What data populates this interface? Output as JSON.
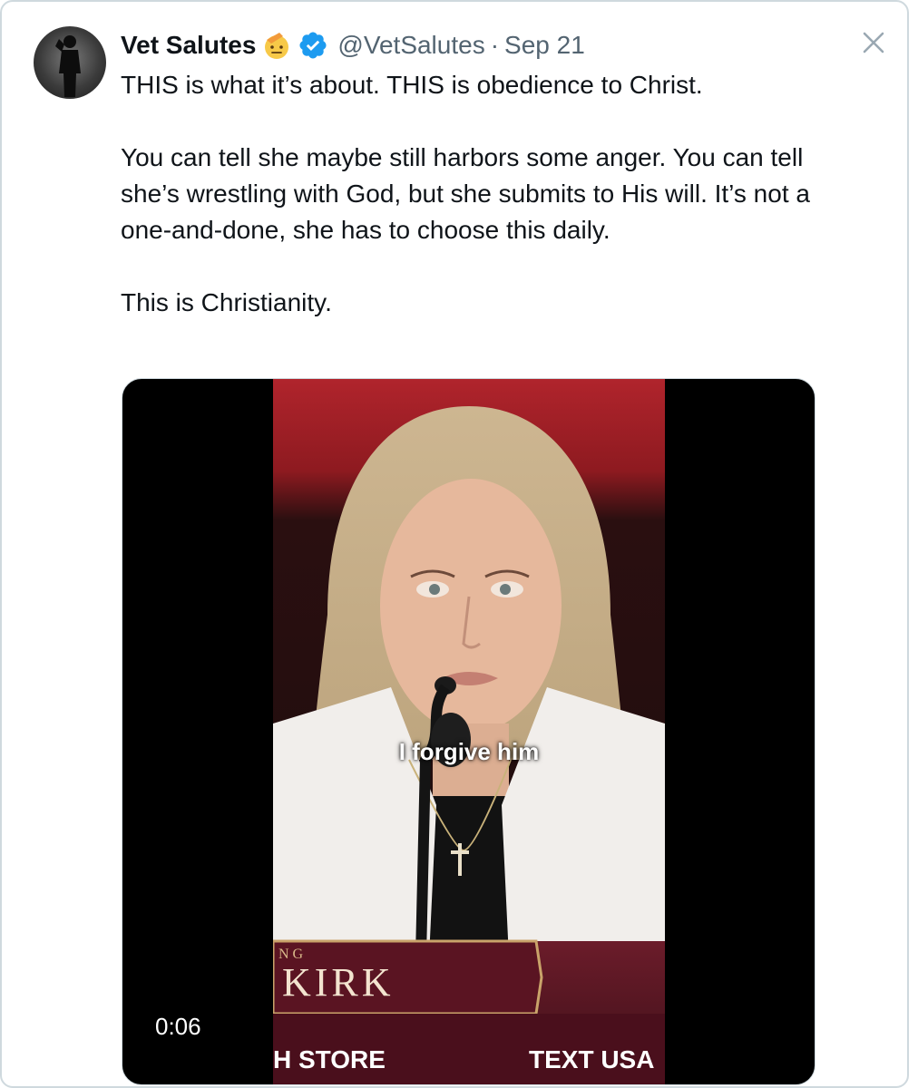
{
  "tweet": {
    "author_name": "Vet Salutes",
    "handle": "@VetSalutes",
    "separator": "·",
    "date": "Sep 21",
    "paragraphs": [
      "THIS is what it’s about. THIS is obedience to Christ.",
      "You can tell she maybe still harbors some anger. You can tell she’s wrestling with God, but she submits to His will. It’s not a one-and-done, she has to choose this daily.",
      "This is Christianity."
    ],
    "close_icon": "close-icon",
    "emoji_icon": "saluting-face-icon",
    "verified_icon": "verified-badge-icon"
  },
  "video": {
    "caption": "I forgive him",
    "banner_small": "NG",
    "banner_large": "KIRK",
    "bottom_left_text": "H STORE",
    "bottom_right_text": "TEXT USA",
    "elapsed_time": "0:06"
  },
  "colors": {
    "verified_blue": "#1d9bf0",
    "secondary_text": "#536471",
    "border": "#cfd9de"
  }
}
